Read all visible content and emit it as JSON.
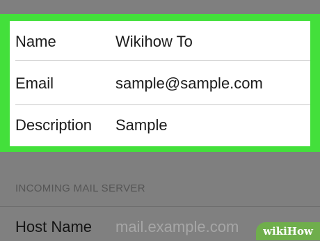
{
  "account_card": {
    "rows": [
      {
        "label": "Name",
        "value": "Wikihow To"
      },
      {
        "label": "Email",
        "value": "sample@sample.com"
      },
      {
        "label": "Description",
        "value": "Sample"
      }
    ],
    "highlight_color": "#43e03b"
  },
  "incoming_section": {
    "header": "INCOMING MAIL SERVER",
    "host_label": "Host Name",
    "host_placeholder": "mail.example.com"
  },
  "watermark": {
    "text_a": "wiki",
    "text_b": "How"
  }
}
